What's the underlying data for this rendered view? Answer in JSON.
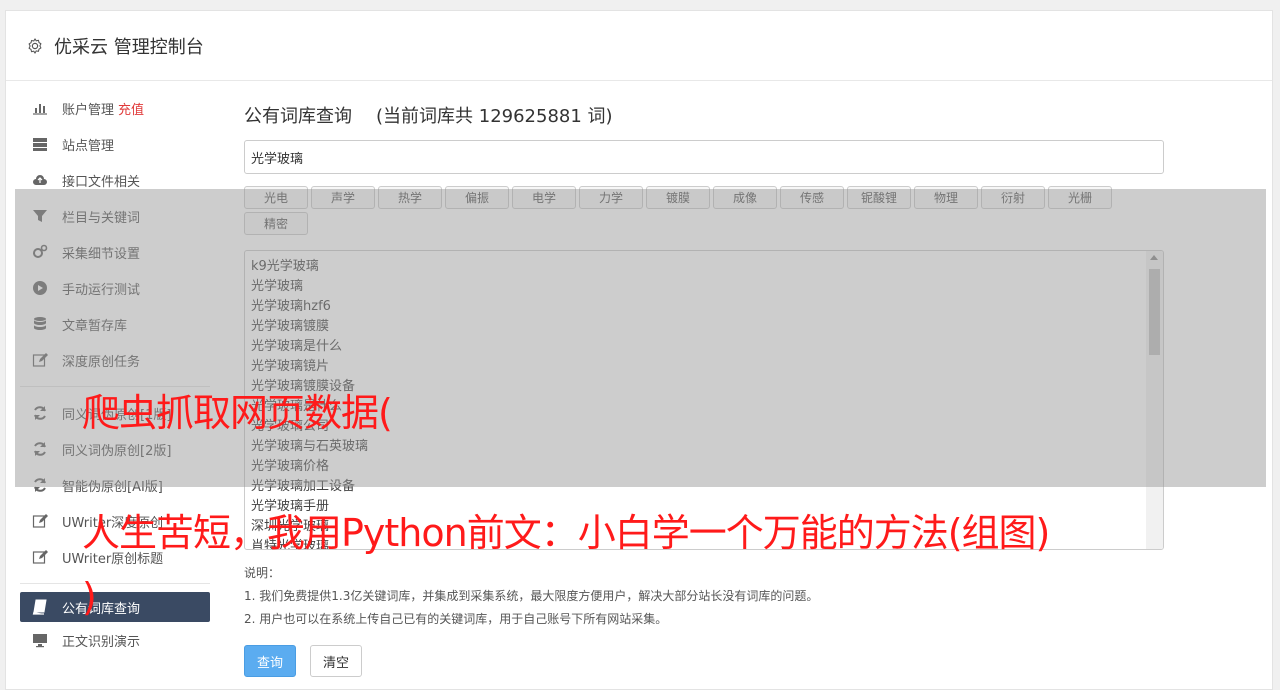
{
  "header": {
    "title": "优采云 管理控制台"
  },
  "sidebar": {
    "items": [
      {
        "label": "账户管理",
        "badge": "充值",
        "icon": "bar-chart-icon"
      },
      {
        "label": "站点管理",
        "icon": "server-icon"
      },
      {
        "label": "接口文件相关",
        "icon": "cloud-upload-icon"
      },
      {
        "label": "栏目与关键词",
        "icon": "filter-icon"
      },
      {
        "label": "采集细节设置",
        "icon": "gears-icon"
      },
      {
        "label": "手动运行测试",
        "icon": "play-circle-icon"
      },
      {
        "label": "文章暂存库",
        "icon": "database-icon"
      },
      {
        "label": "深度原创任务",
        "icon": "edit-icon"
      },
      {
        "label": "同义词伪原创[1版]",
        "icon": "refresh-icon"
      },
      {
        "label": "同义词伪原创[2版]",
        "icon": "refresh-icon"
      },
      {
        "label": "智能伪原创[AI版]",
        "icon": "refresh-icon"
      },
      {
        "label": "UWriter深度原创",
        "icon": "edit-icon"
      },
      {
        "label": "UWriter原创标题",
        "icon": "edit-icon"
      },
      {
        "label": "公有词库查询",
        "icon": "book-icon"
      },
      {
        "label": "正文识别演示",
        "icon": "monitor-icon"
      }
    ]
  },
  "main": {
    "title": "公有词库查询",
    "count_text": "(当前词库共 129625881 词)",
    "search_value": "光学玻璃",
    "tags": [
      "光电",
      "声学",
      "热学",
      "偏振",
      "电学",
      "力学",
      "镀膜",
      "成像",
      "传感",
      "铌酸锂",
      "物理",
      "衍射",
      "光栅",
      "精密"
    ],
    "results": [
      "k9光学玻璃",
      "光学玻璃",
      "光学玻璃hzf6",
      "光学玻璃镀膜",
      "光学玻璃是什么",
      "光学玻璃镜片",
      "光学玻璃镀膜设备",
      "光学玻璃是什么",
      "光学玻璃公司",
      "光学玻璃与石英玻璃",
      "光学玻璃价格",
      "光学玻璃加工设备",
      "光学玻璃手册",
      "深圳光学玻璃",
      "肖特光学玻璃"
    ],
    "notes_title": "说明：",
    "notes": [
      "1. 我们免费提供1.3亿关键词库，并集成到采集系统，最大限度方便用户，解决大部分站长没有词库的问题。",
      "2. 用户也可以在系统上传自己已有的关键词库，用于自己账号下所有网站采集。"
    ],
    "query_button": "查询",
    "clear_button": "清空"
  },
  "overlay_text": {
    "line1": "爬虫抓取网页数据(",
    "line2": "人生苦短，我用Python前文：小白学一个万能的方法(组图)",
    "line3": ")"
  }
}
